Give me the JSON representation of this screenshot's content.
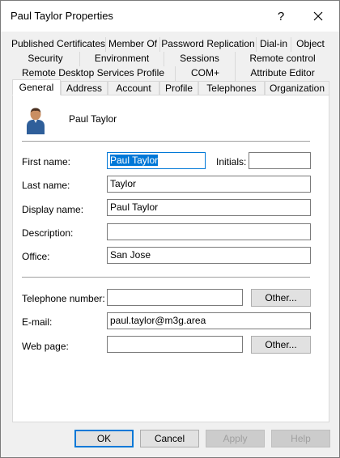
{
  "window": {
    "title": "Paul Taylor Properties",
    "help_glyph": "?"
  },
  "tabs": {
    "row1": [
      "Published Certificates",
      "Member Of",
      "Password Replication",
      "Dial-in",
      "Object"
    ],
    "row2": [
      "Security",
      "Environment",
      "Sessions",
      "Remote control"
    ],
    "row3": [
      "Remote Desktop Services Profile",
      "COM+",
      "Attribute Editor"
    ],
    "row4": [
      "General",
      "Address",
      "Account",
      "Profile",
      "Telephones",
      "Organization"
    ],
    "active": "General"
  },
  "user": {
    "display": "Paul Taylor",
    "icon": "user-icon"
  },
  "form": {
    "first_name": {
      "label": "First name:",
      "value": "Paul Taylor"
    },
    "initials": {
      "label": "Initials:",
      "value": ""
    },
    "last_name": {
      "label": "Last name:",
      "value": "Taylor"
    },
    "display_name": {
      "label": "Display name:",
      "value": "Paul Taylor"
    },
    "description": {
      "label": "Description:",
      "value": ""
    },
    "office": {
      "label": "Office:",
      "value": "San Jose"
    },
    "telephone": {
      "label": "Telephone number:",
      "value": "",
      "other": "Other..."
    },
    "email": {
      "label": "E-mail:",
      "value": "paul.taylor@m3g.area"
    },
    "web_page": {
      "label": "Web page:",
      "value": "",
      "other": "Other..."
    }
  },
  "footer": {
    "ok": "OK",
    "cancel": "Cancel",
    "apply": "Apply",
    "help": "Help"
  },
  "colors": {
    "accent": "#0078d7",
    "window_bg": "#f0f0f0"
  }
}
